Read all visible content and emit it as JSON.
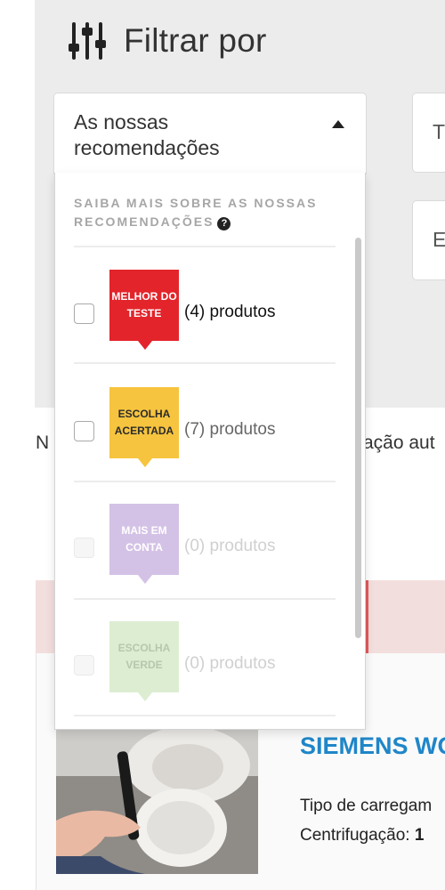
{
  "filter": {
    "title": "Filtrar por",
    "select_label": "As nossas recomendações",
    "side_field_1": "T",
    "side_field_2": "E"
  },
  "dropdown": {
    "heading": "SAIBA MAIS SOBRE AS NOSSAS RECOMENDAÇÕES",
    "options": [
      {
        "badge": "MELHOR DO TESTE",
        "count": "(4) produtos",
        "badge_color": "#e3242b",
        "badge_text_color": "#ffffff",
        "count_color": "#111111",
        "enabled": true
      },
      {
        "badge": "ESCOLHA ACERTADA",
        "count": "(7) produtos",
        "badge_color": "#f6c43e",
        "badge_text_color": "#2b2b2b",
        "count_color": "#666666",
        "enabled": true
      },
      {
        "badge": "MAIS EM CONTA",
        "count": "(0) produtos",
        "badge_color": "#d4c2e6",
        "badge_text_color": "#ffffff",
        "count_color": "#d0d0d0",
        "enabled": false
      },
      {
        "badge": "ESCOLHA VERDE",
        "count": "(0) produtos",
        "badge_color": "#ddedd2",
        "badge_text_color": "#b7c7ad",
        "count_color": "#d0d0d0",
        "enabled": false
      }
    ]
  },
  "background": {
    "left_text": "N",
    "right_text": "ação aut"
  },
  "product": {
    "title": "SIEMENS WO",
    "spec_1": "Tipo de carregam",
    "spec_2_label": "Centrifugação:",
    "spec_2_value": "1"
  },
  "colors": {
    "panel_bg": "#ececec",
    "product_title": "#1f86c8"
  }
}
